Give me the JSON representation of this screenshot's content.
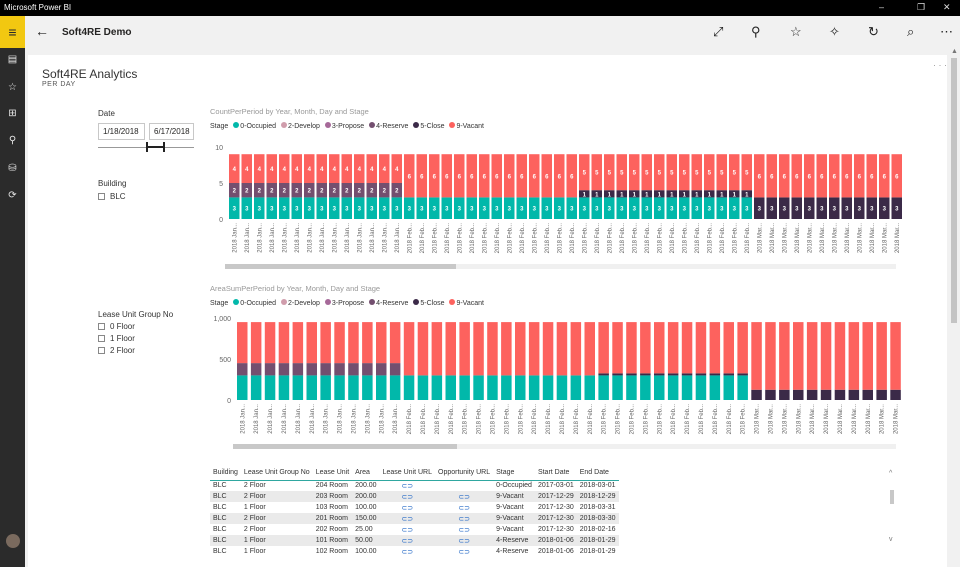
{
  "window": {
    "title": "Microsoft Power BI",
    "minimize": "–",
    "restore": "❐",
    "close": "✕"
  },
  "rail": {
    "menu_icon": "≡",
    "items": [
      "▤",
      "☆",
      "⊞",
      "⚲",
      "⛁",
      "⟳"
    ]
  },
  "topbar": {
    "back": "←",
    "title": "Soft4RE Demo",
    "chevron": "⌄",
    "icons": [
      "⤢",
      "⚲",
      "☆",
      "✧",
      "↻",
      "⌕",
      "⋯"
    ]
  },
  "page": {
    "title": "Soft4RE Analytics",
    "subtitle": "PER DAY",
    "more": "· · ·"
  },
  "filters": {
    "date_label": "Date",
    "date_from": "1/18/2018",
    "date_to": "6/17/2018",
    "building_label": "Building",
    "building_options": [
      "BLC"
    ],
    "lease_label": "Lease Unit Group No",
    "lease_options": [
      "0 Floor",
      "1 Floor",
      "2 Floor"
    ]
  },
  "legend": {
    "label": "Stage",
    "items": [
      {
        "name": "0-Occupied",
        "color": "#01B8AA"
      },
      {
        "name": "2-Develop",
        "color": "#D09DAC"
      },
      {
        "name": "3-Propose",
        "color": "#A66999"
      },
      {
        "name": "4-Reserve",
        "color": "#734F6F"
      },
      {
        "name": "5-Close",
        "color": "#3B2A48"
      },
      {
        "name": "9-Vacant",
        "color": "#FD625E"
      }
    ]
  },
  "chart_data": [
    {
      "type": "bar",
      "title": "CountPerPeriod by Year, Month, Day and Stage",
      "stacked": true,
      "ylim": [
        0,
        10
      ],
      "yticks": [
        "10",
        "5",
        "0"
      ],
      "categories": [
        "2018 Jan...",
        "2018 Jan...",
        "2018 Jan...",
        "2018 Jan...",
        "2018 Jan...",
        "2018 Jan...",
        "2018 Jan...",
        "2018 Jan...",
        "2018 Jan...",
        "2018 Jan...",
        "2018 Jan...",
        "2018 Jan...",
        "2018 Jan...",
        "2018 Jan...",
        "2018 Feb...",
        "2018 Feb...",
        "2018 Feb...",
        "2018 Feb...",
        "2018 Feb...",
        "2018 Feb...",
        "2018 Feb...",
        "2018 Feb...",
        "2018 Feb...",
        "2018 Feb...",
        "2018 Feb...",
        "2018 Feb...",
        "2018 Feb...",
        "2018 Feb...",
        "2018 Feb...",
        "2018 Feb...",
        "2018 Feb...",
        "2018 Feb...",
        "2018 Feb...",
        "2018 Feb...",
        "2018 Feb...",
        "2018 Feb...",
        "2018 Feb...",
        "2018 Feb...",
        "2018 Feb...",
        "2018 Feb...",
        "2018 Feb...",
        "2018 Feb...",
        "2018 Mar...",
        "2018 Mar...",
        "2018 Mar...",
        "2018 Mar...",
        "2018 Mar...",
        "2018 Mar...",
        "2018 Mar...",
        "2018 Mar...",
        "2018 Mar...",
        "2018 Mar...",
        "2018 Mar...",
        "2018 Mar..."
      ],
      "series": [
        {
          "name": "0-Occupied",
          "color": "#01B8AA",
          "values": [
            3,
            3,
            3,
            3,
            3,
            3,
            3,
            3,
            3,
            3,
            3,
            3,
            3,
            3,
            3,
            3,
            3,
            3,
            3,
            3,
            3,
            3,
            3,
            3,
            3,
            3,
            3,
            3,
            3,
            3,
            3,
            3,
            3,
            3,
            3,
            3,
            3,
            3,
            3,
            3,
            3,
            3,
            0,
            0,
            0,
            0,
            0,
            0,
            0,
            0,
            0,
            0,
            0,
            0
          ]
        },
        {
          "name": "4-Reserve",
          "color": "#734F6F",
          "values": [
            2,
            2,
            2,
            2,
            2,
            2,
            2,
            2,
            2,
            2,
            2,
            2,
            2,
            2,
            0,
            0,
            0,
            0,
            0,
            0,
            0,
            0,
            0,
            0,
            0,
            0,
            0,
            0,
            0,
            0,
            0,
            0,
            0,
            0,
            0,
            0,
            0,
            0,
            0,
            0,
            0,
            0,
            0,
            0,
            0,
            0,
            0,
            0,
            0,
            0,
            0,
            0,
            0,
            0
          ]
        },
        {
          "name": "5-Close",
          "color": "#3B2A48",
          "values": [
            0,
            0,
            0,
            0,
            0,
            0,
            0,
            0,
            0,
            0,
            0,
            0,
            0,
            0,
            0,
            0,
            0,
            0,
            0,
            0,
            0,
            0,
            0,
            0,
            0,
            0,
            0,
            0,
            1,
            1,
            1,
            1,
            1,
            1,
            1,
            1,
            1,
            1,
            1,
            1,
            1,
            1,
            3,
            3,
            3,
            3,
            3,
            3,
            3,
            3,
            3,
            3,
            3,
            3
          ]
        },
        {
          "name": "9-Vacant",
          "color": "#FD625E",
          "values": [
            4,
            4,
            4,
            4,
            4,
            4,
            4,
            4,
            4,
            4,
            4,
            4,
            4,
            4,
            6,
            6,
            6,
            6,
            6,
            6,
            6,
            6,
            6,
            6,
            6,
            6,
            6,
            6,
            5,
            5,
            5,
            5,
            5,
            5,
            5,
            5,
            5,
            5,
            5,
            5,
            5,
            5,
            6,
            6,
            6,
            6,
            6,
            6,
            6,
            6,
            6,
            6,
            6,
            6
          ]
        }
      ]
    },
    {
      "type": "bar",
      "title": "AreaSumPerPeriod by Year, Month, Day and Stage",
      "stacked": true,
      "ylim": [
        0,
        1000
      ],
      "yticks": [
        "1,000",
        "500",
        "0"
      ],
      "categories": [
        "2018 Jan...",
        "2018 Jan...",
        "2018 Jan...",
        "2018 Jan...",
        "2018 Jan...",
        "2018 Jan...",
        "2018 Jan...",
        "2018 Jan...",
        "2018 Jan...",
        "2018 Jan...",
        "2018 Jan...",
        "2018 Jan...",
        "2018 Feb...",
        "2018 Feb...",
        "2018 Feb...",
        "2018 Feb...",
        "2018 Feb...",
        "2018 Feb...",
        "2018 Feb...",
        "2018 Feb...",
        "2018 Feb...",
        "2018 Feb...",
        "2018 Feb...",
        "2018 Feb...",
        "2018 Feb...",
        "2018 Feb...",
        "2018 Feb...",
        "2018 Feb...",
        "2018 Feb...",
        "2018 Feb...",
        "2018 Feb...",
        "2018 Feb...",
        "2018 Feb...",
        "2018 Feb...",
        "2018 Feb...",
        "2018 Feb...",
        "2018 Feb...",
        "2018 Mar...",
        "2018 Mar...",
        "2018 Mar...",
        "2018 Mar...",
        "2018 Mar...",
        "2018 Mar...",
        "2018 Mar...",
        "2018 Mar...",
        "2018 Mar...",
        "2018 Mar...",
        "2018 Mar..."
      ],
      "series": [
        {
          "name": "0-Occupied",
          "color": "#01B8AA",
          "values": [
            300,
            300,
            300,
            300,
            300,
            300,
            300,
            300,
            300,
            300,
            300,
            300,
            300,
            300,
            300,
            300,
            300,
            300,
            300,
            300,
            300,
            300,
            300,
            300,
            300,
            300,
            300,
            300,
            300,
            300,
            300,
            300,
            300,
            300,
            300,
            300,
            300,
            0,
            0,
            0,
            0,
            0,
            0,
            0,
            0,
            0,
            0,
            0
          ]
        },
        {
          "name": "4-Reserve",
          "color": "#734F6F",
          "values": [
            150,
            150,
            150,
            150,
            150,
            150,
            150,
            150,
            150,
            150,
            150,
            150,
            0,
            0,
            0,
            0,
            0,
            0,
            0,
            0,
            0,
            0,
            0,
            0,
            0,
            0,
            0,
            0,
            0,
            0,
            0,
            0,
            0,
            0,
            0,
            0,
            0,
            0,
            0,
            0,
            0,
            0,
            0,
            0,
            0,
            0,
            0,
            0
          ]
        },
        {
          "name": "5-Close",
          "color": "#3B2A48",
          "values": [
            0,
            0,
            0,
            0,
            0,
            0,
            0,
            0,
            0,
            0,
            0,
            0,
            0,
            0,
            0,
            0,
            0,
            0,
            0,
            0,
            0,
            0,
            0,
            0,
            0,
            0,
            25,
            25,
            25,
            25,
            25,
            25,
            25,
            25,
            25,
            25,
            25,
            125,
            125,
            125,
            125,
            125,
            125,
            125,
            125,
            125,
            125,
            125
          ]
        },
        {
          "name": "9-Vacant",
          "color": "#FD625E",
          "values": [
            500,
            500,
            500,
            500,
            500,
            500,
            500,
            500,
            500,
            500,
            500,
            500,
            650,
            650,
            650,
            650,
            650,
            650,
            650,
            650,
            650,
            650,
            650,
            650,
            650,
            650,
            625,
            625,
            625,
            625,
            625,
            625,
            625,
            625,
            625,
            625,
            625,
            825,
            825,
            825,
            825,
            825,
            825,
            825,
            825,
            825,
            825,
            825
          ]
        }
      ]
    }
  ],
  "table": {
    "columns": [
      "Building",
      "Lease Unit Group No",
      "Lease Unit",
      "Area",
      "Lease Unit URL",
      "Opportunity URL",
      "Stage",
      "Start Date",
      "End Date"
    ],
    "link_icon": "⊂⊃",
    "rows": [
      [
        "BLC",
        "2 Floor",
        "204 Room",
        "200.00",
        "link",
        "",
        "0-Occupied",
        "2017-03-01",
        "2018-03-01"
      ],
      [
        "BLC",
        "2 Floor",
        "203 Room",
        "200.00",
        "link",
        "link",
        "9-Vacant",
        "2017-12-29",
        "2018-12-29"
      ],
      [
        "BLC",
        "1 Floor",
        "103 Room",
        "100.00",
        "link",
        "link",
        "9-Vacant",
        "2017-12-30",
        "2018-03-31"
      ],
      [
        "BLC",
        "2 Floor",
        "201 Room",
        "150.00",
        "link",
        "link",
        "9-Vacant",
        "2017-12-30",
        "2018-03-30"
      ],
      [
        "BLC",
        "2 Floor",
        "202 Room",
        "25.00",
        "link",
        "link",
        "9-Vacant",
        "2017-12-30",
        "2018-02-16"
      ],
      [
        "BLC",
        "1 Floor",
        "101 Room",
        "50.00",
        "link",
        "link",
        "4-Reserve",
        "2018-01-06",
        "2018-01-29"
      ],
      [
        "BLC",
        "1 Floor",
        "102 Room",
        "100.00",
        "link",
        "link",
        "4-Reserve",
        "2018-01-06",
        "2018-01-29"
      ]
    ]
  }
}
